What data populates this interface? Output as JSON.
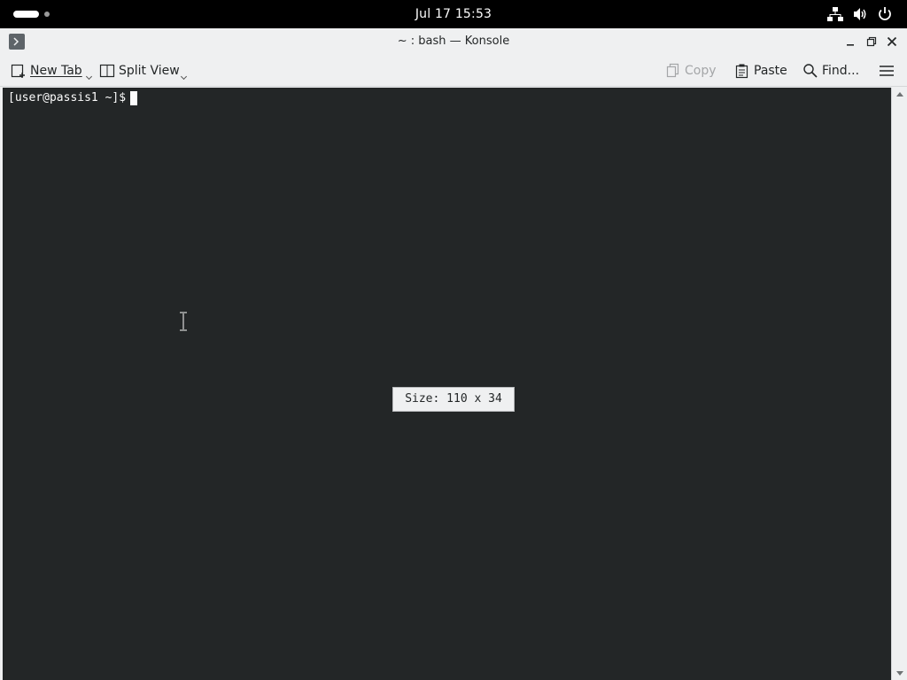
{
  "topbar": {
    "clock": "Jul 17  15:53",
    "tray_icons": [
      "network-icon",
      "volume-icon",
      "power-icon"
    ]
  },
  "window": {
    "title": "~ : bash — Konsole",
    "app_icon": "konsole-icon"
  },
  "toolbar": {
    "new_tab_label": "New Tab",
    "split_view_label": "Split View",
    "copy_label": "Copy",
    "paste_label": "Paste",
    "find_label": "Find..."
  },
  "terminal": {
    "prompt": "[user@passis1 ~]$",
    "size_popup": "Size: 110 x 34",
    "background": "#232627",
    "foreground": "#fcfcfc"
  }
}
